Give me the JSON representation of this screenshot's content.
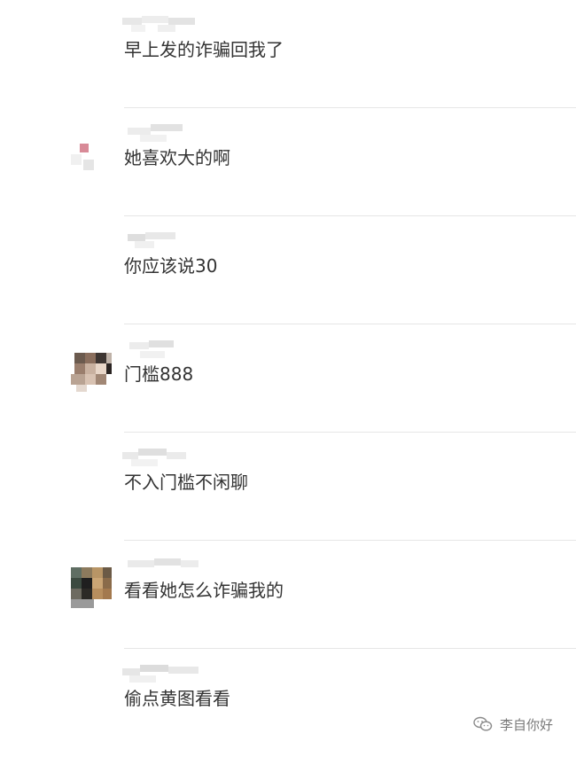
{
  "comments": [
    {
      "text": "早上发的诈骗回我了"
    },
    {
      "text": "她喜欢大的啊"
    },
    {
      "text": "你应该说30"
    },
    {
      "text": "门槛888"
    },
    {
      "text": "不入门槛不闲聊"
    },
    {
      "text": "看看她怎么诈骗我的"
    },
    {
      "text": "偷点黄图看看"
    }
  ],
  "watermark": {
    "label": "李自你好"
  }
}
